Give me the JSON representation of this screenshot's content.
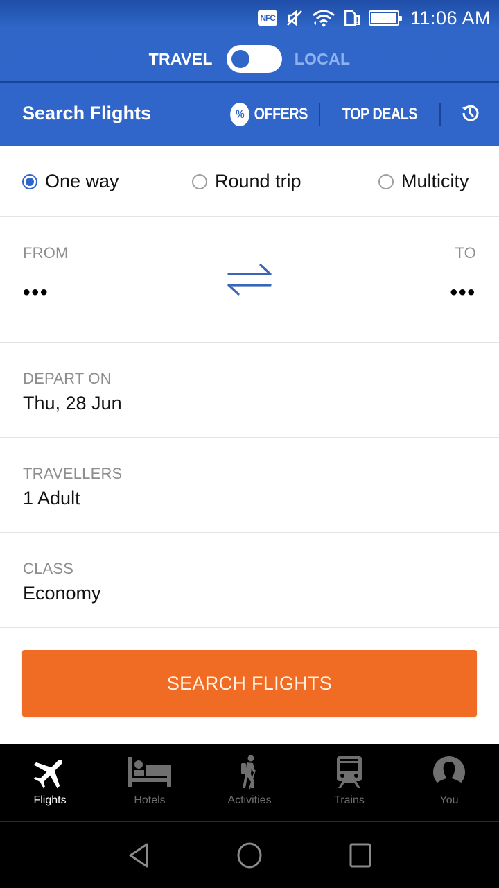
{
  "status_bar": {
    "time": "11:06 AM",
    "nfc_label": "NFC",
    "icons": [
      "nfc-icon",
      "mute-icon",
      "wifi-icon",
      "sim-alert-icon",
      "battery-icon"
    ]
  },
  "mode_toggle": {
    "left_label": "TRAVEL",
    "right_label": "LOCAL",
    "selected": "TRAVEL"
  },
  "header": {
    "title": "Search Flights",
    "offers_label": "OFFERS",
    "offers_badge": "%",
    "top_deals_label": "TOP DEALS",
    "history_icon": "history-icon"
  },
  "trip_type": {
    "options": [
      {
        "label": "One way",
        "checked": true
      },
      {
        "label": "Round trip",
        "checked": false
      },
      {
        "label": "Multicity",
        "checked": false
      }
    ]
  },
  "route": {
    "from_label": "FROM",
    "from_value": "•••",
    "to_label": "TO",
    "to_value": "•••",
    "swap_icon": "swap-arrows-icon"
  },
  "fields": {
    "depart": {
      "label": "DEPART ON",
      "value": "Thu, 28 Jun"
    },
    "travellers": {
      "label": "TRAVELLERS",
      "value": "1 Adult"
    },
    "class": {
      "label": "CLASS",
      "value": "Economy"
    }
  },
  "search_button": {
    "label": "SEARCH FLIGHTS"
  },
  "bottom_nav": {
    "items": [
      {
        "label": "Flights",
        "icon": "airplane-icon",
        "active": true
      },
      {
        "label": "Hotels",
        "icon": "bed-icon",
        "active": false
      },
      {
        "label": "Activities",
        "icon": "hiker-icon",
        "active": false
      },
      {
        "label": "Trains",
        "icon": "train-icon",
        "active": false
      },
      {
        "label": "You",
        "icon": "profile-icon",
        "active": false
      }
    ]
  },
  "system_nav": [
    "back",
    "home",
    "recents"
  ],
  "colors": {
    "brand_blue": "#3066c9",
    "accent_orange": "#f06b23",
    "nav_active": "#ffffff",
    "nav_inactive": "#6f6f6f"
  }
}
